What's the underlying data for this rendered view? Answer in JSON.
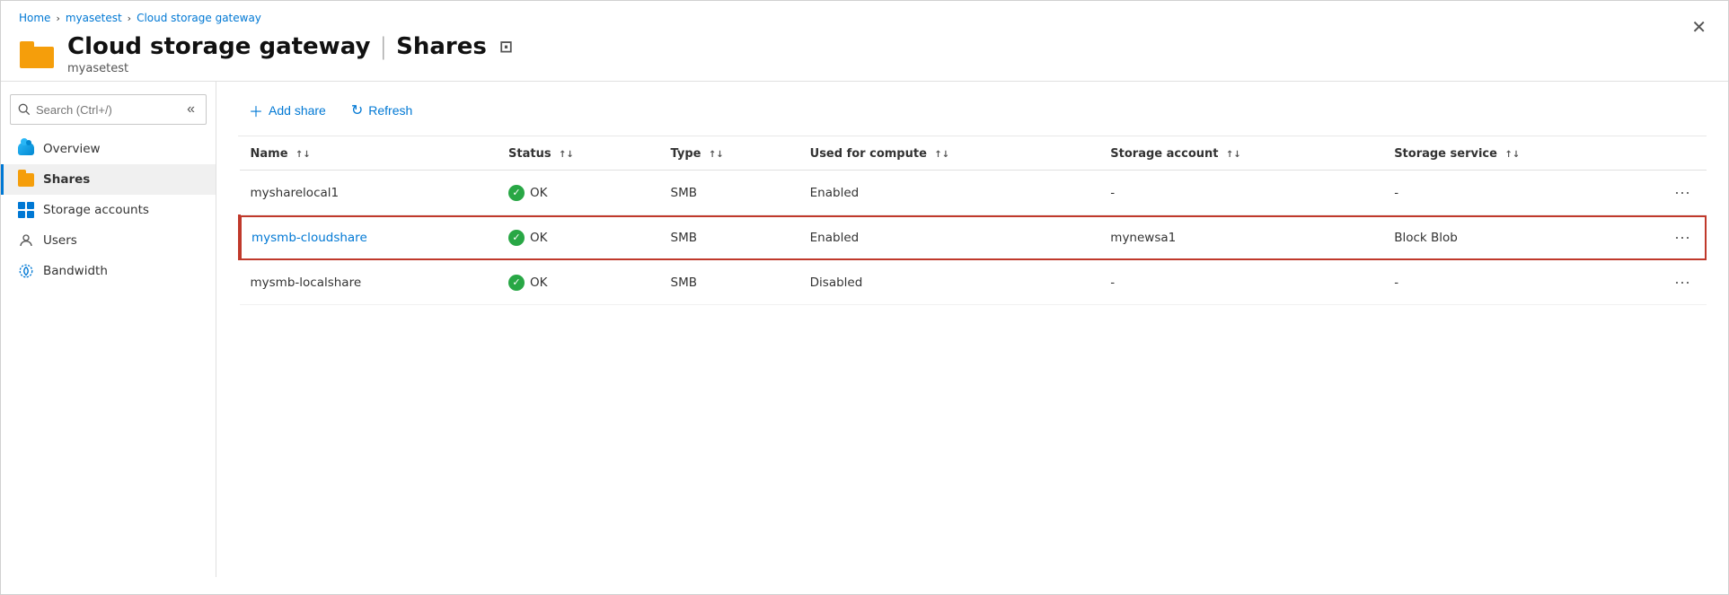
{
  "breadcrumb": {
    "home": "Home",
    "myasetest": "myasetest",
    "current": "Cloud storage gateway"
  },
  "title": {
    "main": "Cloud storage gateway",
    "section": "Shares",
    "subtitle": "myasetest",
    "pin_icon": "📌"
  },
  "sidebar": {
    "search_placeholder": "Search (Ctrl+/)",
    "items": [
      {
        "id": "overview",
        "label": "Overview",
        "icon": "cloud"
      },
      {
        "id": "shares",
        "label": "Shares",
        "icon": "folder",
        "active": true
      },
      {
        "id": "storage-accounts",
        "label": "Storage accounts",
        "icon": "storage"
      },
      {
        "id": "users",
        "label": "Users",
        "icon": "user"
      },
      {
        "id": "bandwidth",
        "label": "Bandwidth",
        "icon": "bandwidth"
      }
    ]
  },
  "toolbar": {
    "add_label": "Add share",
    "refresh_label": "Refresh"
  },
  "table": {
    "columns": [
      {
        "id": "name",
        "label": "Name"
      },
      {
        "id": "status",
        "label": "Status"
      },
      {
        "id": "type",
        "label": "Type"
      },
      {
        "id": "compute",
        "label": "Used for compute"
      },
      {
        "id": "storage_account",
        "label": "Storage account"
      },
      {
        "id": "storage_service",
        "label": "Storage service"
      }
    ],
    "rows": [
      {
        "name": "mysharelocal1",
        "status": "OK",
        "type": "SMB",
        "compute": "Enabled",
        "storage_account": "-",
        "storage_service": "-",
        "selected": false
      },
      {
        "name": "mysmb-cloudshare",
        "status": "OK",
        "type": "SMB",
        "compute": "Enabled",
        "storage_account": "mynewsa1",
        "storage_service": "Block Blob",
        "selected": true
      },
      {
        "name": "mysmb-localshare",
        "status": "OK",
        "type": "SMB",
        "compute": "Disabled",
        "storage_account": "-",
        "storage_service": "-",
        "selected": false
      }
    ]
  }
}
